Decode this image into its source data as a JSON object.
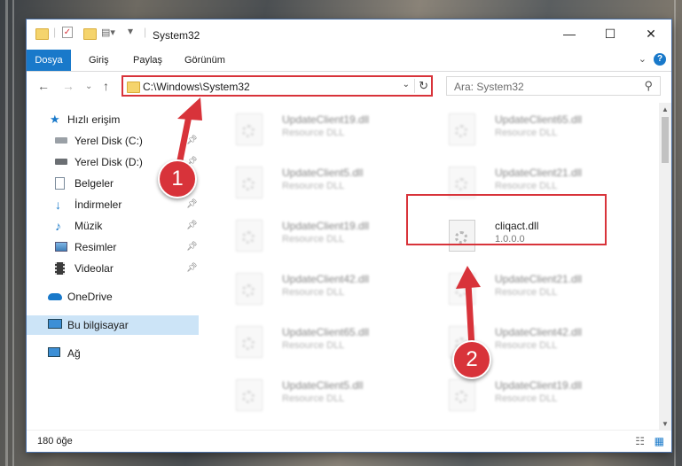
{
  "window": {
    "title": "System32",
    "minimize_glyph": "—",
    "maximize_glyph": "☐",
    "close_glyph": "✕"
  },
  "ribbon": {
    "tabs": [
      {
        "label": "Dosya"
      },
      {
        "label": "Giriş"
      },
      {
        "label": "Paylaş"
      },
      {
        "label": "Görünüm"
      }
    ],
    "help_glyph": "?"
  },
  "nav": {
    "address": "C:\\Windows\\System32",
    "search_placeholder": "Ara: System32"
  },
  "sidebar": {
    "items": [
      {
        "label": "Hızlı erişim",
        "icon": "star-icon"
      },
      {
        "label": "Yerel Disk (C:)",
        "icon": "drive-icon",
        "pinned": true
      },
      {
        "label": "Yerel Disk (D:)",
        "icon": "drive-icon",
        "pinned": true
      },
      {
        "label": "Belgeler",
        "icon": "document-icon",
        "pinned": true
      },
      {
        "label": "İndirmeler",
        "icon": "download-icon",
        "pinned": true
      },
      {
        "label": "Müzik",
        "icon": "music-icon",
        "pinned": true
      },
      {
        "label": "Resimler",
        "icon": "pictures-icon",
        "pinned": true
      },
      {
        "label": "Videolar",
        "icon": "video-icon",
        "pinned": true
      },
      {
        "label": "OneDrive",
        "icon": "cloud-icon"
      },
      {
        "label": "Bu bilgisayar",
        "icon": "computer-icon",
        "selected": true
      },
      {
        "label": "Ağ",
        "icon": "network-icon"
      }
    ]
  },
  "files": {
    "left": [
      {
        "name": "UpdateClient19.dll",
        "desc": "Resource DLL"
      },
      {
        "name": "UpdateClient5.dll",
        "desc": "Resource DLL"
      },
      {
        "name": "UpdateClient19.dll",
        "desc": "Resource DLL"
      },
      {
        "name": "UpdateClient42.dll",
        "desc": "Resource DLL"
      },
      {
        "name": "UpdateClient65.dll",
        "desc": "Resource DLL"
      },
      {
        "name": "UpdateClient5.dll",
        "desc": "Resource DLL"
      }
    ],
    "right": [
      {
        "name": "UpdateClient65.dll",
        "desc": "Resource DLL"
      },
      {
        "name": "UpdateClient21.dll",
        "desc": "Resource DLL"
      },
      {
        "name": "cliqact.dll",
        "desc": "1.0.0.0",
        "highlighted": true
      },
      {
        "name": "UpdateClient21.dll",
        "desc": "Resource DLL"
      },
      {
        "name": "UpdateClient42.dll",
        "desc": "Resource DLL"
      },
      {
        "name": "UpdateClient19.dll",
        "desc": "Resource DLL"
      }
    ]
  },
  "status": {
    "count": "180 öğe"
  },
  "callouts": [
    {
      "label": "1"
    },
    {
      "label": "2"
    }
  ],
  "colors": {
    "accent": "#1979ca",
    "highlight": "#d8333a",
    "selected_bg": "#cce4f7"
  }
}
